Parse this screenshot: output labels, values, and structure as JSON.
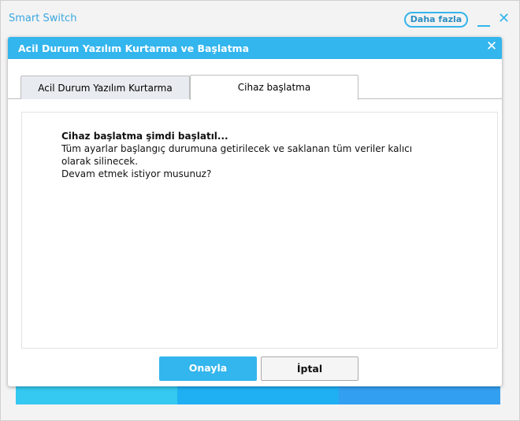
{
  "app": {
    "title": "Smart Switch",
    "more_label": "Daha fazla"
  },
  "dialog": {
    "title": "Acil Durum Yazılım Kurtarma ve Başlatma",
    "tabs": [
      {
        "label": "Acil Durum Yazılım Kurtarma",
        "active": false
      },
      {
        "label": "Cihaz başlatma",
        "active": true
      }
    ],
    "message": {
      "heading": "Cihaz başlatma şimdi başlatıl...",
      "line1": "Tüm ayarlar başlangıç durumuna getirilecek ve saklanan tüm veriler kalıcı olarak silinecek.",
      "line2": "Devam etmek istiyor musunuz?"
    },
    "confirm_label": "Onayla",
    "cancel_label": "İptal"
  },
  "colors": {
    "accent": "#33b5ed",
    "stripe1": "#35c8f0",
    "stripe2": "#1fb0f3",
    "stripe3": "#339ff0"
  }
}
